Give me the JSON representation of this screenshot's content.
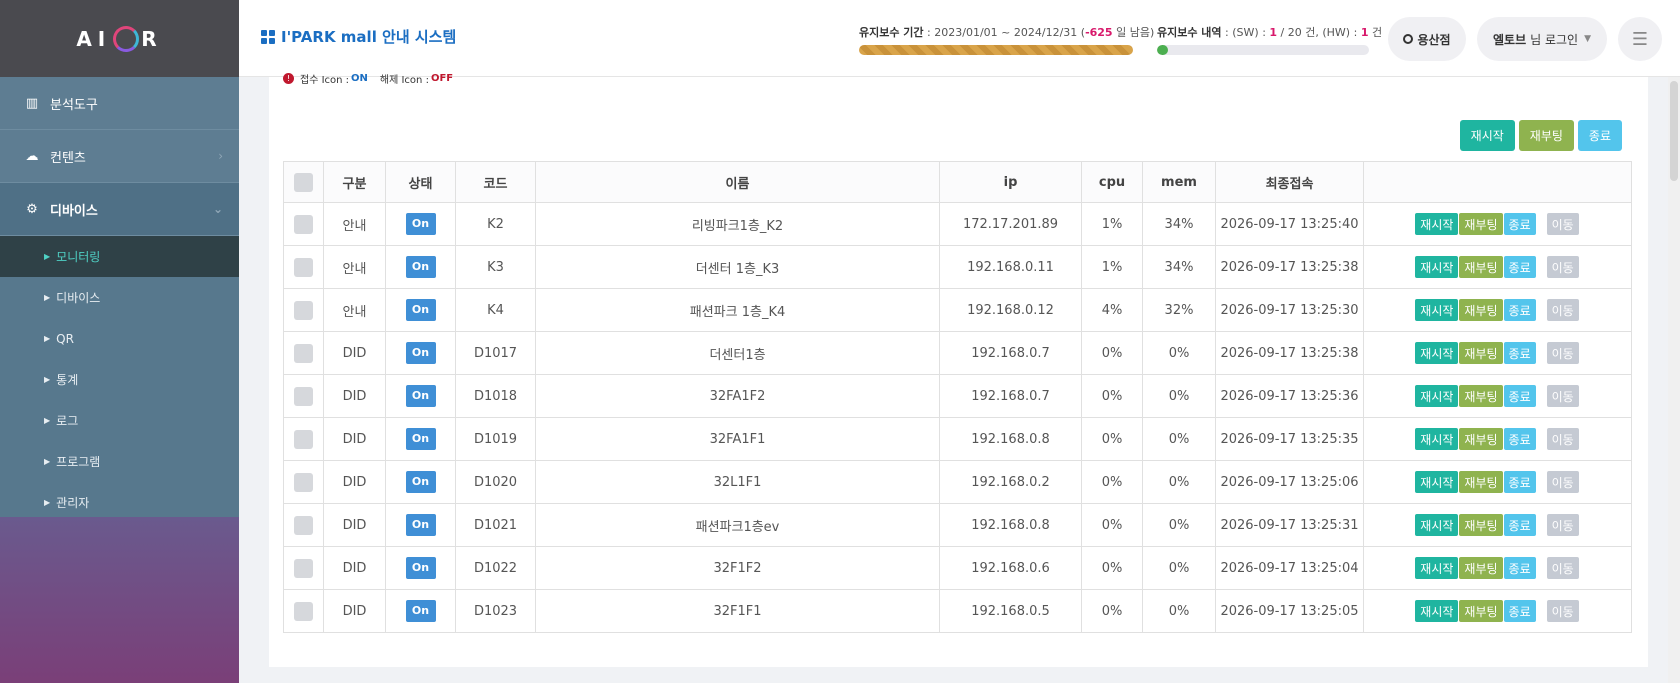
{
  "brand": {
    "logo_left": "AI",
    "logo_right": "R"
  },
  "sidebar": {
    "items": [
      {
        "label": "분석도구",
        "icon": "chart-icon"
      },
      {
        "label": "컨텐츠",
        "icon": "cloud-upload-icon"
      },
      {
        "label": "디바이스",
        "icon": "gear-icon"
      }
    ],
    "sub_items": [
      {
        "label": "모니터링"
      },
      {
        "label": "디바이스"
      },
      {
        "label": "QR"
      },
      {
        "label": "통계"
      },
      {
        "label": "로그"
      },
      {
        "label": "프로그램"
      },
      {
        "label": "관리자"
      }
    ]
  },
  "header": {
    "title": "I'PARK mall 안내 시스템",
    "maint_label": "유지보수 기간",
    "maint_range": " : 2023/01/01 ~ 2024/12/31 (",
    "maint_days": "-625",
    "maint_suffix": " 일 남음)",
    "maint_progress": 1.0,
    "hist_label": "유지보수 내역",
    "hist_sw_pre": " : (SW) : ",
    "hist_sw_count": "1",
    "hist_sw_total": " / 20 건, (HW) : ",
    "hist_hw_count": "1",
    "hist_hw_suffix": " 건",
    "hist_progress": 0.05,
    "store": "용산점",
    "user_name": "엘토브",
    "user_suffix": "님 로그인"
  },
  "legend": {
    "prefix": "접수 Icon : ",
    "on": "ON",
    "mid": "해제 Icon : ",
    "off": "OFF"
  },
  "actions": {
    "restart": "재시작",
    "reboot": "재부팅",
    "end": "종료",
    "move": "이동"
  },
  "table": {
    "headers": [
      "구분",
      "상태",
      "코드",
      "이름",
      "ip",
      "cpu",
      "mem",
      "최종접속"
    ],
    "status_label": "On",
    "rows": [
      {
        "type": "안내",
        "code": "K2",
        "name": "리빙파크1층_K2",
        "ip": "172.17.201.89",
        "cpu": "1%",
        "mem": "34%",
        "last": "2026-09-17 13:25:40"
      },
      {
        "type": "안내",
        "code": "K3",
        "name": "더센터 1층_K3",
        "ip": "192.168.0.11",
        "cpu": "1%",
        "mem": "34%",
        "last": "2026-09-17 13:25:38"
      },
      {
        "type": "안내",
        "code": "K4",
        "name": "패션파크 1층_K4",
        "ip": "192.168.0.12",
        "cpu": "4%",
        "mem": "32%",
        "last": "2026-09-17 13:25:30"
      },
      {
        "type": "DID",
        "code": "D1017",
        "name": "더센터1층",
        "ip": "192.168.0.7",
        "cpu": "0%",
        "mem": "0%",
        "last": "2026-09-17 13:25:38"
      },
      {
        "type": "DID",
        "code": "D1018",
        "name": "32FA1F2",
        "ip": "192.168.0.7",
        "cpu": "0%",
        "mem": "0%",
        "last": "2026-09-17 13:25:36"
      },
      {
        "type": "DID",
        "code": "D1019",
        "name": "32FA1F1",
        "ip": "192.168.0.8",
        "cpu": "0%",
        "mem": "0%",
        "last": "2026-09-17 13:25:35"
      },
      {
        "type": "DID",
        "code": "D1020",
        "name": "32L1F1",
        "ip": "192.168.0.2",
        "cpu": "0%",
        "mem": "0%",
        "last": "2026-09-17 13:25:06"
      },
      {
        "type": "DID",
        "code": "D1021",
        "name": "패션파크1층ev",
        "ip": "192.168.0.8",
        "cpu": "0%",
        "mem": "0%",
        "last": "2026-09-17 13:25:31"
      },
      {
        "type": "DID",
        "code": "D1022",
        "name": "32F1F2",
        "ip": "192.168.0.6",
        "cpu": "0%",
        "mem": "0%",
        "last": "2026-09-17 13:25:04"
      },
      {
        "type": "DID",
        "code": "D1023",
        "name": "32F1F1",
        "ip": "192.168.0.5",
        "cpu": "0%",
        "mem": "0%",
        "last": "2026-09-17 13:25:05"
      }
    ]
  }
}
